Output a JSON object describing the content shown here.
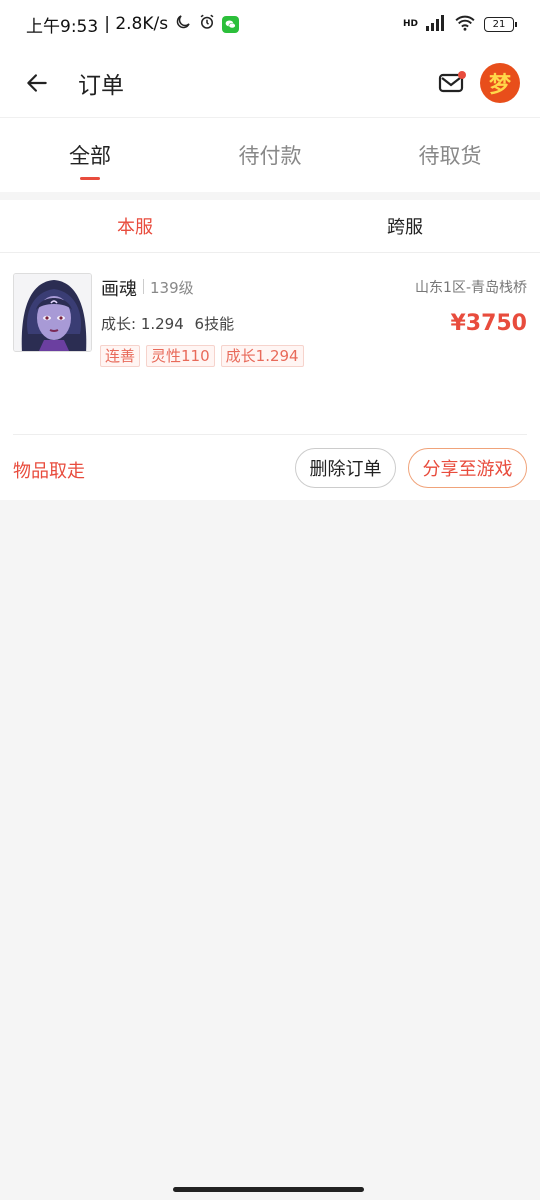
{
  "status_bar": {
    "time": "上午9:53",
    "speed": "| 2.8K/s",
    "network": "HD",
    "battery": "21"
  },
  "header": {
    "title": "订单",
    "logo_text": "梦"
  },
  "tabs": [
    {
      "label": "全部",
      "active": true
    },
    {
      "label": "待付款",
      "active": false
    },
    {
      "label": "待取货",
      "active": false
    }
  ],
  "subtabs": [
    {
      "label": "本服",
      "active": true
    },
    {
      "label": "跨服",
      "active": false
    }
  ],
  "order": {
    "name": "画魂",
    "level": "139级",
    "server": "山东1区-青岛栈桥",
    "growth_text": "成长: 1.294",
    "skills_text": "6技能",
    "price": "¥3750",
    "tags": [
      "连善",
      "灵性110",
      "成长1.294"
    ],
    "pickup_status": "物品取走",
    "delete_label": "删除订单",
    "share_label": "分享至游戏"
  },
  "colors": {
    "accent": "#e84c3d",
    "logo": "#e84e1b",
    "wechat": "#2bbf3a"
  }
}
